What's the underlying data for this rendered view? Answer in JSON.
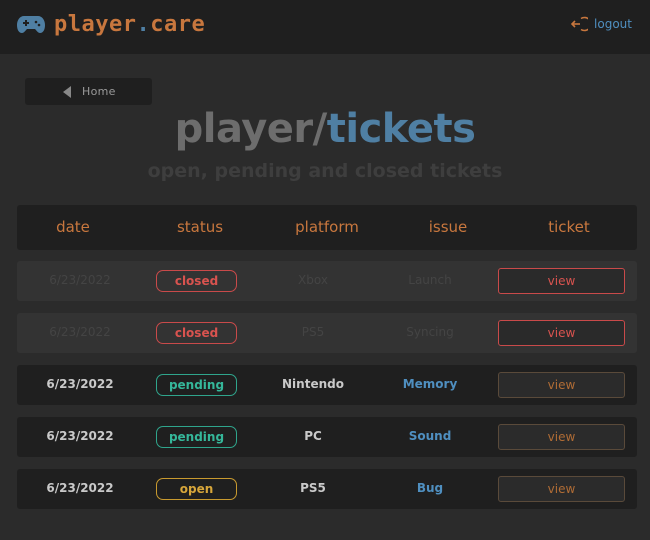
{
  "brand": {
    "part1": "player",
    "dot": ".",
    "part2": "care"
  },
  "logout_label": "logout",
  "home_label": "Home",
  "title": {
    "part1": "player",
    "slash": "/",
    "part2": "tickets"
  },
  "subtitle": "open, pending and closed tickets",
  "columns": [
    "date",
    "status",
    "platform",
    "issue",
    "ticket"
  ],
  "rows": [
    {
      "date": "6/23/2022",
      "status": "closed",
      "platform": "Xbox",
      "issue": "Launch",
      "action": "view"
    },
    {
      "date": "6/23/2022",
      "status": "closed",
      "platform": "PS5",
      "issue": "Syncing",
      "action": "view"
    },
    {
      "date": "6/23/2022",
      "status": "pending",
      "platform": "Nintendo",
      "issue": "Memory",
      "action": "view"
    },
    {
      "date": "6/23/2022",
      "status": "pending",
      "platform": "PC",
      "issue": "Sound",
      "action": "view"
    },
    {
      "date": "6/23/2022",
      "status": "open",
      "platform": "PS5",
      "issue": "Bug",
      "action": "view"
    }
  ],
  "colors": {
    "accent_orange": "#c8773e",
    "accent_blue": "#4f7fa3",
    "status_closed": "#d9534f",
    "status_pending": "#35b79a",
    "status_open": "#d7a63a"
  },
  "icons": {
    "logo": "gamepad-icon",
    "logout": "logout-icon",
    "home": "back-arrow-icon"
  }
}
